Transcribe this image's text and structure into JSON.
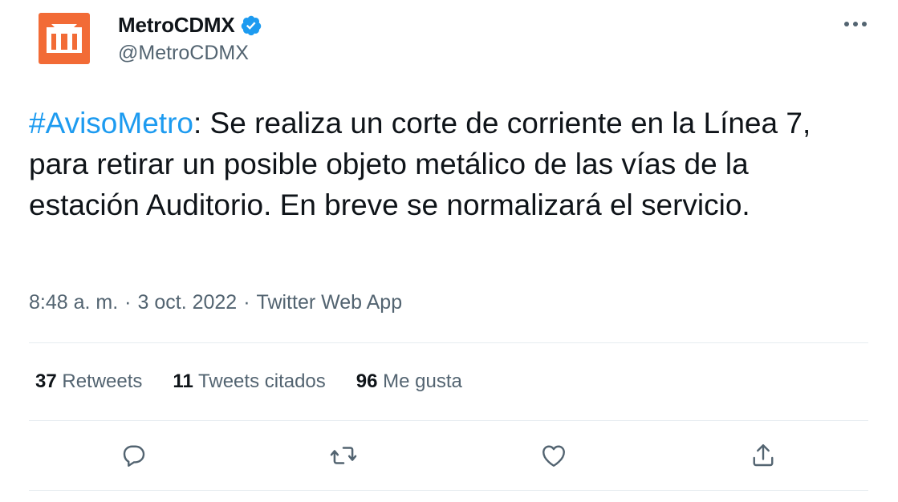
{
  "author": {
    "name": "MetroCDMX",
    "handle": "@MetroCDMX",
    "avatar_icon": "metro-logo-icon",
    "verified_icon": "verified-badge-icon"
  },
  "tweet": {
    "hashtag": "#AvisoMetro",
    "text": ": Se realiza un corte de corriente en la Línea 7, para retirar un posible objeto metálico de las vías de la estación Auditorio. En breve se normalizará el servicio."
  },
  "meta": {
    "time": "8:48 a. m.",
    "sep1": "·",
    "date": "3 oct. 2022",
    "sep2": "·",
    "source": "Twitter Web App"
  },
  "stats": {
    "retweets_count": "37",
    "retweets_label": "Retweets",
    "quotes_count": "11",
    "quotes_label": "Tweets citados",
    "likes_count": "96",
    "likes_label": "Me gusta"
  },
  "actions": {
    "reply_icon": "reply-icon",
    "retweet_icon": "retweet-icon",
    "like_icon": "heart-icon",
    "share_icon": "share-icon"
  },
  "colors": {
    "link": "#1d9bf0",
    "secondary_text": "#536471",
    "metro_orange": "#f26b36",
    "verified_blue": "#1d9bf0"
  }
}
